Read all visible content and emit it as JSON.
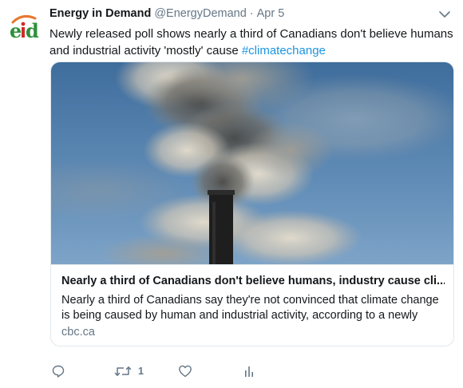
{
  "tweet": {
    "author_name": "Energy in Demand",
    "author_handle": "@EnergyDemand",
    "separator": "·",
    "date": "Apr 5",
    "text_main": "Newly released poll shows nearly a third of Canadians don't believe humans and industrial activity 'mostly' cause ",
    "hashtag": "#climatechange",
    "avatar_logo": "eid",
    "caret_icon": "chevron-down-icon"
  },
  "card": {
    "title": "Nearly a third of Canadians don't believe humans, industry cause cli...",
    "description": "Nearly a third of Canadians say they're not convinced that climate change is being caused by human and industrial activity, according to a newly",
    "domain": "cbc.ca",
    "image_subject": "smokestack emitting smoke against blue sky"
  },
  "actions": {
    "reply_icon": "reply-icon",
    "retweet_icon": "retweet-icon",
    "retweet_count": "1",
    "like_icon": "heart-icon",
    "analytics_icon": "analytics-icon"
  },
  "colors": {
    "text": "#14171a",
    "secondary": "#657786",
    "link": "#1b95e0",
    "border": "#e1e8ed"
  }
}
